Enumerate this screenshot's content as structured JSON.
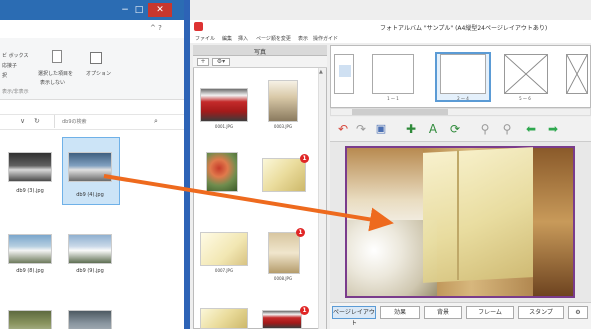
{
  "explorer": {
    "ribbon": {
      "item1": "ビ ボックス",
      "item2": "応接子",
      "item3": "択",
      "group": "表示/非表示",
      "hide_selected_l1": "選択した項目を",
      "hide_selected_l2": "表示しない",
      "options": "オプション"
    },
    "help_glyph": "^ ?",
    "address": {
      "chevron": "∨",
      "refresh": "↻"
    },
    "search": {
      "placeholder": "db9の検索",
      "icon": "⌕"
    },
    "files": [
      {
        "name": "db9 (3).jpg"
      },
      {
        "name": "db9 (4).jpg",
        "selected": true
      },
      {
        "name": "db9 (8).jpg"
      },
      {
        "name": "db9 (9).jpg"
      }
    ],
    "window_controls": {
      "minimize": "−",
      "maximize": "□",
      "close": "✕"
    }
  },
  "app": {
    "title": "フォトアルバム \"サンプル\" (A4縦型24ページレイアウトあり)",
    "menu": [
      "ファイル",
      "編集",
      "挿入",
      "ページ順を変更",
      "表示",
      "操作ガイド"
    ],
    "photo_panel": {
      "title": "写真",
      "toolbar": [
        "+",
        "⚙▾"
      ],
      "photos": [
        {
          "name": "0001.JPG"
        },
        {
          "name": "0003.JPG"
        },
        {
          "name": "",
          "badge": ""
        },
        {
          "name": "",
          "badge": "1"
        },
        {
          "name": "0007.JPG"
        },
        {
          "name": "0008.JPG",
          "badge": "1"
        },
        {
          "name": "",
          "badge": ""
        },
        {
          "name": "",
          "badge": "1"
        }
      ]
    },
    "page_strip": {
      "pages": [
        {
          "label": ""
        },
        {
          "label": "1 ～ 1"
        },
        {
          "label": "2 ～ 4"
        },
        {
          "label": "5 ～ 6"
        }
      ]
    },
    "tabs": [
      "ページレイアウト",
      "効果",
      "背景",
      "フレーム",
      "スタンプ",
      "⚙"
    ],
    "active_tab": "ページレイアウト",
    "colors": {
      "title_bar": "#2b6cb3",
      "divider": "#2d63b6",
      "close": "#c7372f",
      "badge": "#e02626",
      "canvas_border": "#7a3c8c",
      "drag_arrow": "#ee6a1e"
    },
    "icons": [
      "undo-icon",
      "redo-icon",
      "save-icon",
      "add-photo-icon",
      "add-text-icon",
      "refresh-icon",
      "zoom-out-icon",
      "zoom-in-icon",
      "prev-arrow-icon",
      "next-arrow-icon"
    ]
  }
}
